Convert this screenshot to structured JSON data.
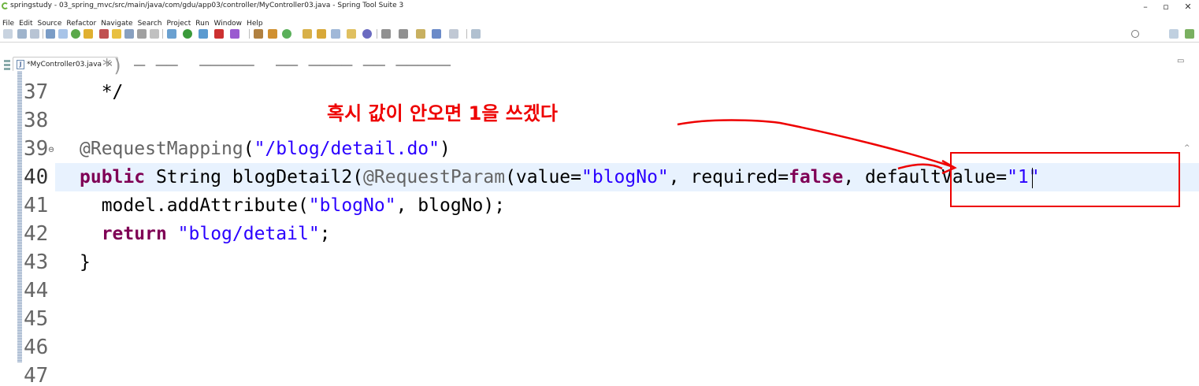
{
  "window": {
    "title": "springstudy - 03_spring_mvc/src/main/java/com/gdu/app03/controller/MyController03.java - Spring Tool Suite 3",
    "controls": [
      "–",
      "▫",
      "✕"
    ]
  },
  "menu": [
    "File",
    "Edit",
    "Source",
    "Refactor",
    "Navigate",
    "Search",
    "Project",
    "Run",
    "Window",
    "Help"
  ],
  "tab": {
    "label": "*MyController03.java",
    "close": "×"
  },
  "editor": {
    "lines": [
      {
        "no": "37",
        "text": "  */"
      },
      {
        "no": "38",
        "text": ""
      },
      {
        "no": "39",
        "marker": "⊖",
        "text": "@RequestMapping(\"/blog/detail.do\")"
      },
      {
        "no": "40",
        "text": "public String blogDetail2(@RequestParam(value=\"blogNo\", required=false, defaultValue=\"1\""
      },
      {
        "no": "41",
        "text": "  model.addAttribute(\"blogNo\", blogNo);"
      },
      {
        "no": "42",
        "text": "  return \"blog/detail\";"
      },
      {
        "no": "43",
        "text": "}"
      },
      {
        "no": "44",
        "text": ""
      },
      {
        "no": "45",
        "text": ""
      },
      {
        "no": "46",
        "text": ""
      },
      {
        "no": "47",
        "text": ""
      }
    ],
    "annotation": "혹시 값이 안오면 1을 쓰겠다"
  },
  "colors": {
    "annotation_red": "#ee0000",
    "keyword": "#7f0055",
    "string": "#2a00ff",
    "annotation_code": "#646464",
    "current_line": "#e8f2fe"
  }
}
